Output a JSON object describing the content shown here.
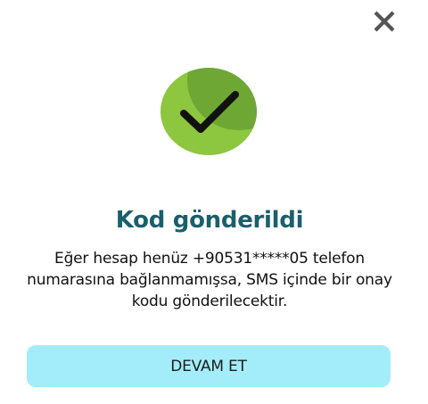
{
  "dialog": {
    "close_icon": "close-icon",
    "success_icon": "checkmark-icon",
    "title": "Kod gönderildi",
    "message": "Eğer hesap henüz +90531*****05 telefon numarasına bağlanmamışsa, SMS içinde bir onay kodu gönderilecektir.",
    "continue_label": "DEVAM ET"
  },
  "colors": {
    "title": "#1b5f6b",
    "button_bg": "#a3edfb",
    "badge_light": "#8dc63f",
    "badge_dark": "#6ea733",
    "close_icon": "#555555"
  }
}
